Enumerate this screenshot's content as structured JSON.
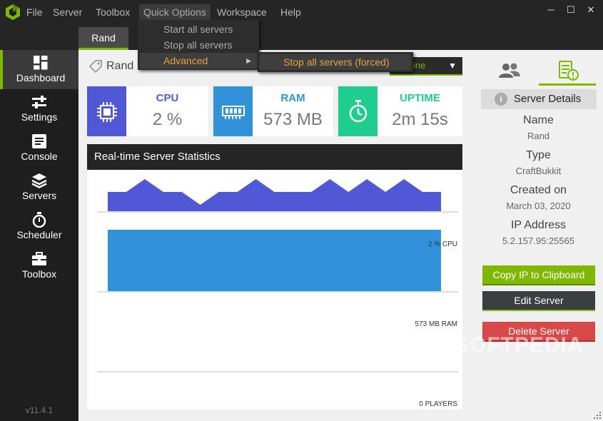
{
  "menu": {
    "items": [
      "File",
      "Server",
      "Toolbox",
      "Quick Options",
      "Workspace",
      "Help"
    ],
    "active": "Quick Options"
  },
  "window": {
    "minimize": "─",
    "maximize": "☐",
    "close": "✕"
  },
  "tabs": [
    {
      "label": "Rand"
    }
  ],
  "quick_options": {
    "items": [
      "Start all servers",
      "Stop all servers",
      "Advanced"
    ],
    "selected": "Advanced",
    "submenu": [
      "Stop all servers (forced)"
    ]
  },
  "sidebar": {
    "items": [
      {
        "label": "Dashboard",
        "icon": "dashboard-icon"
      },
      {
        "label": "Settings",
        "icon": "sliders-icon"
      },
      {
        "label": "Console",
        "icon": "console-icon"
      },
      {
        "label": "Servers",
        "icon": "layers-icon"
      },
      {
        "label": "Scheduler",
        "icon": "stopwatch-icon"
      },
      {
        "label": "Toolbox",
        "icon": "toolbox-icon"
      }
    ],
    "active": "Dashboard",
    "version": "v11.4.1"
  },
  "main": {
    "server_name": "Rand",
    "status": "line",
    "cards": [
      {
        "title": "CPU",
        "value": "2 %",
        "color": "#5158d6",
        "icon": "cpu-icon"
      },
      {
        "title": "RAM",
        "value": "573 MB",
        "color": "#3191d9",
        "icon": "ram-icon"
      },
      {
        "title": "UPTIME",
        "value": "2m 15s",
        "color": "#1fce8f",
        "icon": "stopwatch-icon"
      }
    ],
    "stats_title": "Real-time Server Statistics",
    "cpu_label": "2 % CPU",
    "ram_label": "573 MB RAM",
    "players_label": "0 PLAYERS"
  },
  "details": {
    "header": "Server Details",
    "rows": [
      {
        "label": "Name",
        "value": "Rand"
      },
      {
        "label": "Type",
        "value": "CraftBukkit"
      },
      {
        "label": "Created on",
        "value": "March 03, 2020"
      },
      {
        "label": "IP Address",
        "value": "5.2.157.95:25565"
      }
    ],
    "buttons": {
      "copy_ip": "Copy IP to Clipboard",
      "edit": "Edit Server",
      "delete": "Delete Server"
    }
  },
  "colors": {
    "accent": "#7fb800",
    "cpu": "#5158d6",
    "ram": "#3191d9",
    "uptime": "#1fce8f",
    "delete": "#d84848",
    "edit": "#3c3f41",
    "menu_highlight": "#e8a33a"
  },
  "watermark": "SOFTPEDIA",
  "chart_data": {
    "type": "area",
    "series": [
      {
        "name": "CPU",
        "values": [
          1.5,
          1.5,
          2.5,
          1.5,
          1.5,
          0.5,
          1.5,
          1.5,
          2.5,
          1.5,
          1.5,
          1.5,
          2.5,
          1.5,
          2.5,
          1.5,
          2.5,
          1.5,
          1.5
        ]
      },
      {
        "name": "RAM",
        "values": [
          573,
          573,
          573,
          573,
          573,
          573,
          573,
          573,
          573,
          573,
          573,
          573,
          573,
          573,
          573,
          573,
          573,
          573,
          573
        ]
      },
      {
        "name": "PLAYERS",
        "values": [
          0,
          0,
          0,
          0,
          0,
          0,
          0,
          0,
          0,
          0,
          0,
          0,
          0,
          0,
          0,
          0,
          0,
          0,
          0
        ]
      }
    ],
    "ylim_cpu": [
      0,
      3
    ],
    "ylim_ram": [
      0,
      573
    ]
  }
}
